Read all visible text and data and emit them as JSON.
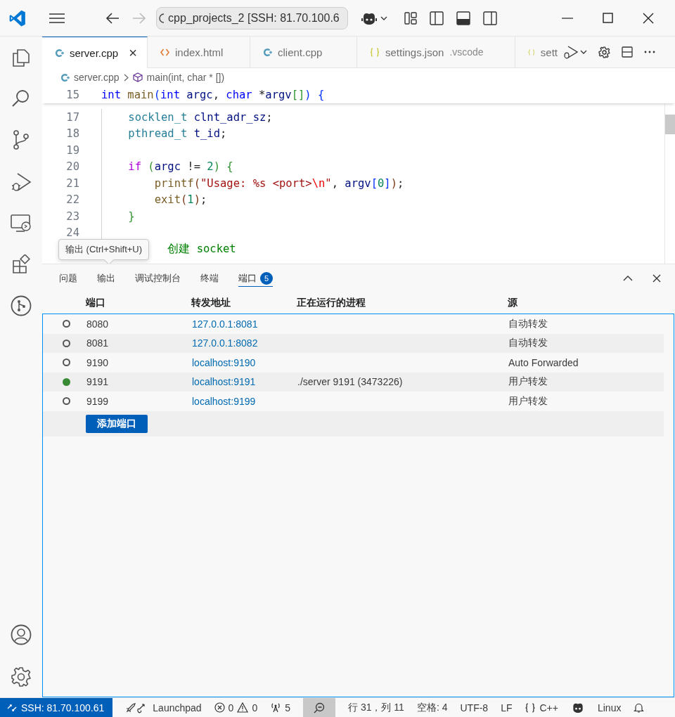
{
  "title_bar": {
    "command_center": "cpp_projects_2 [SSH: 81.70.100.6",
    "back_disabled": false,
    "forward_disabled": true
  },
  "tabs": [
    {
      "label": "server.cpp",
      "kind": "cpp",
      "selected": true,
      "close": "×"
    },
    {
      "label": "index.html",
      "kind": "html",
      "selected": false
    },
    {
      "label": "client.cpp",
      "kind": "cpp",
      "selected": false
    },
    {
      "label": "settings.json",
      "kind": "json",
      "selected": false,
      "description": ".vscode"
    },
    {
      "label": "sett",
      "kind": "json",
      "selected": false
    }
  ],
  "breadcrumb": {
    "file": "server.cpp",
    "symbol": "main(int, char * [])"
  },
  "editor": {
    "sticky_line": {
      "number": "15",
      "tokens": [
        {
          "text": "int ",
          "kind": "kw"
        },
        {
          "text": "main",
          "kind": "fn"
        },
        {
          "text": "(",
          "kind": "b1"
        },
        {
          "text": "int ",
          "kind": "kw"
        },
        {
          "text": "argc",
          "kind": "var"
        },
        {
          "text": ", ",
          "kind": "plain"
        },
        {
          "text": "char",
          "kind": "kw"
        },
        {
          "text": " *",
          "kind": "plain"
        },
        {
          "text": "argv",
          "kind": "var"
        },
        {
          "text": "[]",
          "kind": "b2"
        },
        {
          "text": ") ",
          "kind": "b1"
        },
        {
          "text": "{",
          "kind": "b1"
        }
      ]
    },
    "lines": [
      {
        "number": "17",
        "tokens": [
          {
            "text": "    socklen_t ",
            "kind": "type"
          },
          {
            "text": "clnt_adr_sz",
            "kind": "var"
          },
          {
            "text": ";",
            "kind": "plain"
          }
        ]
      },
      {
        "number": "18",
        "tokens": [
          {
            "text": "    pthread_t ",
            "kind": "type"
          },
          {
            "text": "t_id",
            "kind": "var"
          },
          {
            "text": ";",
            "kind": "plain"
          }
        ]
      },
      {
        "number": "19"
      },
      {
        "number": "20",
        "tokens": [
          {
            "text": "    if ",
            "kind": "ctl"
          },
          {
            "text": "(",
            "kind": "b2"
          },
          {
            "text": "argc",
            "kind": "var"
          },
          {
            "text": " != ",
            "kind": "plain"
          },
          {
            "text": "2",
            "kind": "num"
          },
          {
            "text": ") {",
            "kind": "b2"
          }
        ]
      },
      {
        "number": "21",
        "tokens": [
          {
            "text": "        printf",
            "kind": "fn"
          },
          {
            "text": "(",
            "kind": "b3"
          },
          {
            "text": "\"Usage: %s <port>",
            "kind": "str"
          },
          {
            "text": "\\n",
            "kind": "esc"
          },
          {
            "text": "\"",
            "kind": "str"
          },
          {
            "text": ", ",
            "kind": "plain"
          },
          {
            "text": "argv",
            "kind": "var"
          },
          {
            "text": "[",
            "kind": "b1"
          },
          {
            "text": "0",
            "kind": "num"
          },
          {
            "text": "]",
            "kind": "b1"
          },
          {
            "text": ")",
            "kind": "b3"
          },
          {
            "text": ";",
            "kind": "plain"
          }
        ]
      },
      {
        "number": "22",
        "tokens": [
          {
            "text": "        exit",
            "kind": "fn"
          },
          {
            "text": "(",
            "kind": "b3"
          },
          {
            "text": "1",
            "kind": "num"
          },
          {
            "text": ")",
            "kind": "b3"
          },
          {
            "text": ";",
            "kind": "plain"
          }
        ]
      },
      {
        "number": "23",
        "tokens": [
          {
            "text": "    }",
            "kind": "b2"
          }
        ]
      },
      {
        "number": "24"
      },
      {
        "tokens": [
          {
            "text": "          创建 socket",
            "kind": "comment"
          }
        ]
      }
    ],
    "tooltip": "输出 (Ctrl+Shift+U)"
  },
  "panel": {
    "tabs": [
      {
        "label": "问题",
        "selected": false
      },
      {
        "label": "输出",
        "selected": false
      },
      {
        "label": "调试控制台",
        "selected": false
      },
      {
        "label": "终端",
        "selected": false
      },
      {
        "label": "端口",
        "selected": true,
        "badge": "5"
      }
    ],
    "columns": [
      "端口",
      "转发地址",
      "正在运行的进程",
      "源"
    ],
    "rows": [
      {
        "running": false,
        "port": "8080",
        "address": "127.0.0.1:8081",
        "source": "自动转发"
      },
      {
        "running": false,
        "port": "8081",
        "address": "127.0.0.1:8082",
        "source": "自动转发"
      },
      {
        "running": false,
        "port": "9190",
        "address": "localhost:9190",
        "source": "Auto Forwarded"
      },
      {
        "running": true,
        "port": "9191",
        "address": "localhost:9191",
        "process": "./server 9191 (3473226)",
        "source": "用户转发"
      },
      {
        "running": false,
        "port": "9199",
        "address": "localhost:9199",
        "source": "用户转发"
      }
    ],
    "add_button": "添加端口"
  },
  "status_bar": {
    "remote": "SSH: 81.70.100.61",
    "launchpad": "Launchpad",
    "errors": "0",
    "warnings": "0",
    "ports": "5",
    "position": "行 31，列 11",
    "spaces": "空格: 4",
    "encoding": "UTF-8",
    "eol": "LF",
    "language": "C++",
    "os": "Linux"
  }
}
